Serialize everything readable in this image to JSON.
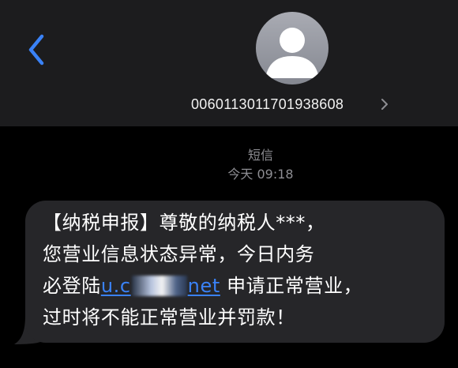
{
  "header": {
    "back_icon": "chevron-left-icon",
    "avatar_icon": "person-silhouette-icon",
    "contact_number": "0060113011701938608",
    "contact_chevron_icon": "chevron-right-icon"
  },
  "conversation": {
    "service_label": "短信",
    "timestamp": "今天 09:18"
  },
  "message": {
    "line1": "【纳税申报】尊敬的纳税人***，",
    "line2": "您营业信息状态异常，今日内务",
    "line3_prefix": "必登陆",
    "link_start": "u.c",
    "link_end": "net",
    "line3_suffix": "申请正常营业，",
    "line4": "过时将不能正常营业并罚款！"
  },
  "colors": {
    "background": "#000000",
    "header_background": "#1c1c1e",
    "bubble": "#262629",
    "accent_blue": "#3a82f7",
    "meta_gray": "#8e8e93"
  }
}
